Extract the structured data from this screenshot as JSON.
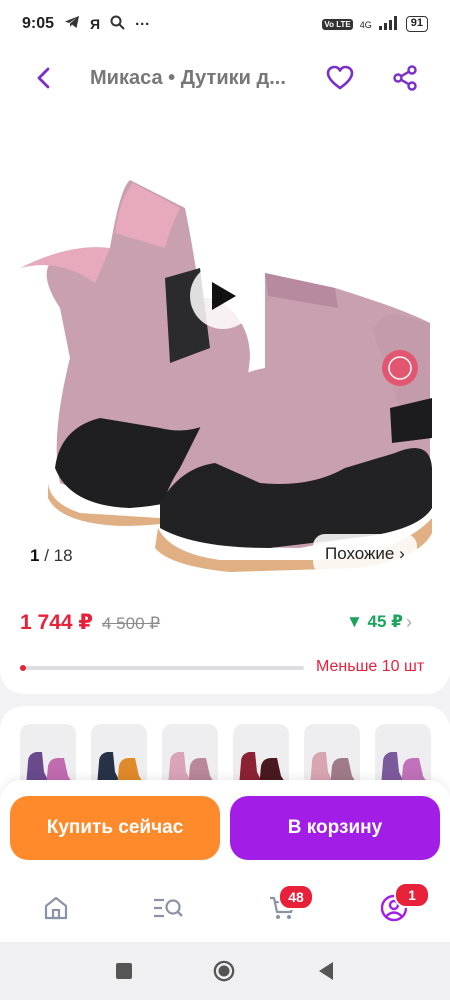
{
  "status_bar": {
    "time": "9:05",
    "notif_letter": "Я",
    "more": "···",
    "network": "4G",
    "vo_badge": "Vo LTE",
    "battery": "91"
  },
  "header": {
    "title": "Микаса • Дутики д...",
    "icons": [
      "back-arrow-icon",
      "heart-icon",
      "share-icon"
    ]
  },
  "gallery": {
    "counter_current": "1",
    "counter_total": "/ 18",
    "similar_label": "Похожие ›",
    "play_icon": "play-icon"
  },
  "price": {
    "current": "1 744 ₽",
    "old": "4 500 ₽",
    "cashback": "▼ 45 ₽",
    "cashback_arrow": "›",
    "stock_label": "Меньше 10 шт",
    "stock_fraction": 0.02
  },
  "variants": [
    {
      "colors": [
        "#6a4a8c",
        "#c06bb0"
      ]
    },
    {
      "colors": [
        "#273247",
        "#e08a2a"
      ]
    },
    {
      "colors": [
        "#d9a3b9",
        "#b8879a"
      ]
    },
    {
      "colors": [
        "#8c2233",
        "#4a1820"
      ]
    },
    {
      "colors": [
        "#d8a6b0",
        "#a07a88"
      ]
    },
    {
      "colors": [
        "#7b5a9c",
        "#c071b9"
      ]
    }
  ],
  "actions": {
    "buy_now": "Купить сейчас",
    "add_to_cart": "В корзину"
  },
  "bottom_nav": {
    "cart_badge": "48",
    "profile_badge": "1",
    "icons": [
      "home-icon",
      "catalog-search-icon",
      "cart-icon",
      "profile-icon"
    ]
  },
  "colors": {
    "accent": "#a21ee6",
    "buy": "#ff8a2b",
    "price_red": "#e8213b",
    "cashback_green": "#1aa35b"
  }
}
